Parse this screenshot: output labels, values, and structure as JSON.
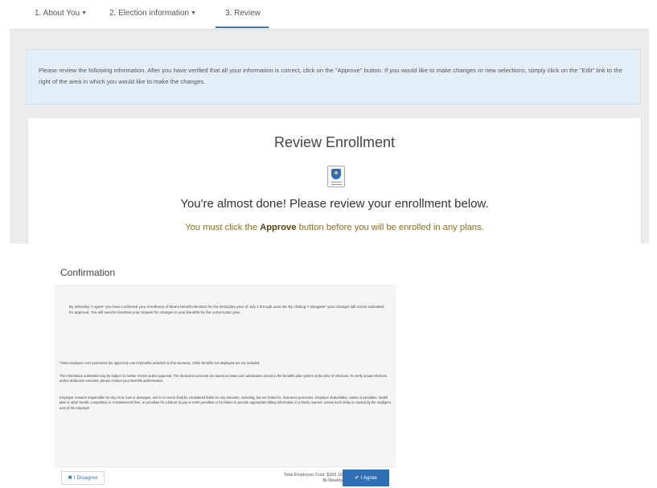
{
  "tabs": [
    {
      "label": "1. About You",
      "has_dropdown": true,
      "active": false
    },
    {
      "label": "2. Election information",
      "has_dropdown": true,
      "active": false
    },
    {
      "label": "3. Review",
      "has_dropdown": false,
      "active": true
    }
  ],
  "icons": {
    "dropdown": "chevron-down-icon",
    "document": "shield-document-icon",
    "disagree": "x-icon",
    "agree": "checkmark-icon"
  },
  "colors": {
    "accent": "#2f6fb8",
    "info_background": "#e3eef7",
    "warning_text": "#8d6d1e"
  },
  "info_message": "Please review the following information. After you have verified that all your information is correct, click on the \"Approve\" button. If you would like to make changes or new selections, simply click on the \"Edit\" link to the right of the area in which you would like to make the changes.",
  "review": {
    "title": "Review Enrollment",
    "almost_done": "You're almost done! Please review your enrollment below.",
    "must_prefix": "You must click the ",
    "must_bold": "Approve",
    "must_suffix": " button before you will be enrolled in any plans."
  },
  "confirmation": {
    "title": "Confirmation",
    "main_paragraph": "By selecting \"I Agree\" you have confirmed your enrollment of Miami benefit elections for the 2018 plan year of July 1 through June 30. By clicking \"I Disagree\" your changes will not be submitted for approval. You will need to resubmit your request for changes in your benefits for the current plan year.",
    "paragraph_1": "*Total employee cost represents the approved cost of benefits included on this summary. Other benefits not displayed are not included.",
    "paragraph_2": "The information submitted may be subject to further review and/or approval. The deduction amounts are based on rates and calculations stored in the benefits plan system at the time of elections. To verify actual elections and/or deduction amounts, please contact your benefits administrator.",
    "paragraph_3": "Employer remains responsible for any error, loss or damages, and in no event shall be considered liable for any amounts, including, but not limited to, insurance premiums, employer deductibles, claims or penalties, health plan or other health, competition or reinstatement fees, or penalties for a failure to pay or remit penalties or for failure to provide appropriate billing information in a timely manner, unless such delay is caused by the negligent acts of the employer.",
    "disagree_label": "I Disagree",
    "total_cost_line1": "Total Employee Cost: $368.16",
    "total_cost_line2": "Bi-Weekly",
    "agree_label": "I Agree"
  }
}
